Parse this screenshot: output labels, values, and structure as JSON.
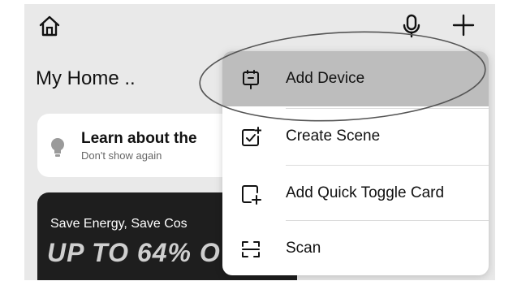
{
  "header": {
    "home_icon": "home-icon",
    "mic_icon": "microphone-icon",
    "plus_icon": "plus-icon"
  },
  "home": {
    "title": "My Home .."
  },
  "learn_card": {
    "title": "Learn about the",
    "subtitle": "Don't show again",
    "icon": "lightbulb-icon"
  },
  "promo": {
    "line1": "Save Energy, Save Cos",
    "line2": "UP TO 64% O"
  },
  "menu": {
    "items": [
      {
        "label": "Add Device",
        "icon": "device-icon",
        "highlighted": true
      },
      {
        "label": "Create Scene",
        "icon": "scene-icon",
        "highlighted": false
      },
      {
        "label": "Add Quick Toggle Card",
        "icon": "add-card-icon",
        "highlighted": false
      },
      {
        "label": "Scan",
        "icon": "scan-icon",
        "highlighted": false
      }
    ]
  },
  "colors": {
    "screen_bg": "#e9e9e9",
    "menu_bg": "#ffffff",
    "highlight": "#bdbdbd",
    "promo_bg": "#1e1e1e"
  }
}
